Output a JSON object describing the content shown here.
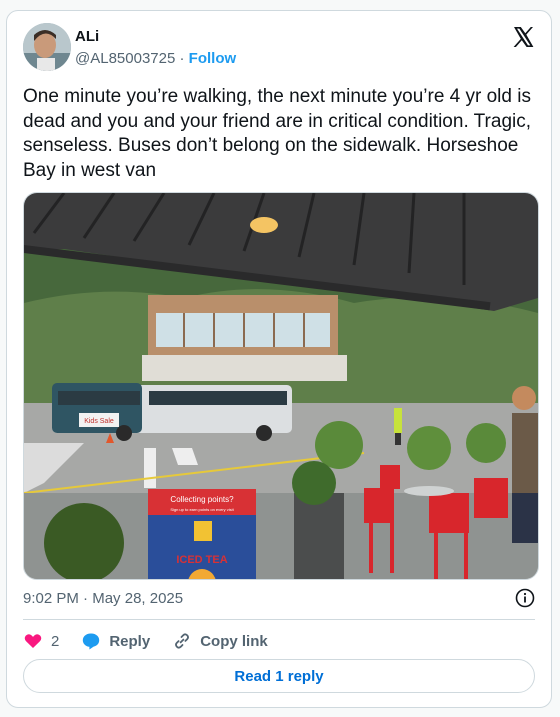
{
  "author": {
    "name": "ALi",
    "handle": "@AL85003725",
    "separator": "·",
    "follow_label": "Follow"
  },
  "platform_icon": "x-logo-icon",
  "tweet_text": "One minute you’re walking, the next minute you’re 4 yr old is dead and you and your friend are in critical condition. Tragic, senseless. Buses don’t belong on the sidewalk. Horseshoe Bay in west van",
  "media": {
    "sign_top": "Collecting points?",
    "sign_sub": "Sign up to earn points on every visit",
    "sign_brand": "ICED TEA",
    "bus_ad": "Kids Sale"
  },
  "meta": {
    "time": "9:02 PM",
    "separator": "·",
    "date": "May 28, 2025"
  },
  "actions": {
    "like_count": "2",
    "reply_label": "Reply",
    "copy_label": "Copy link"
  },
  "read_reply_label": "Read 1 reply",
  "colors": {
    "like": "#f91880",
    "reply": "#1d9bf0",
    "link": "#006fd6",
    "text_secondary": "#536471"
  }
}
